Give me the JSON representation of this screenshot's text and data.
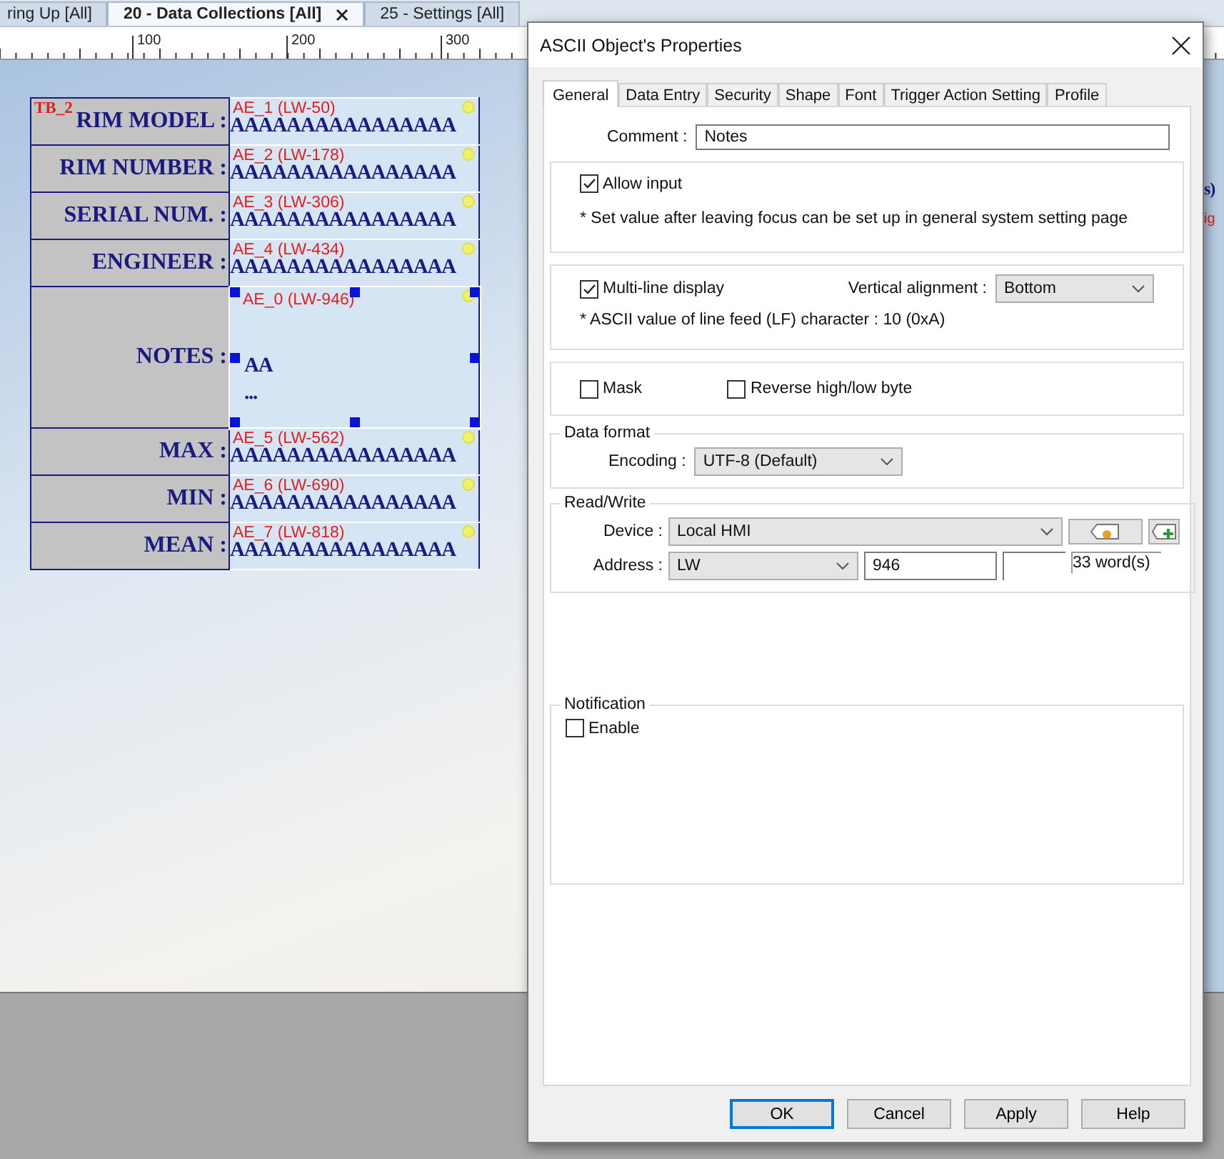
{
  "editor_tabs": [
    {
      "label": "ring Up [All]",
      "selected": false,
      "closable": false
    },
    {
      "label": "20 - Data Collections [All]",
      "selected": true,
      "closable": true
    },
    {
      "label": "25 - Settings [All]",
      "selected": false,
      "closable": false
    }
  ],
  "ruler": {
    "labels": [
      "100",
      "200",
      "300"
    ]
  },
  "canvas": {
    "table_tag": "TB_2",
    "rows": [
      {
        "label": "RIM MODEL :",
        "tag": "AE_1 (LW-50)",
        "kind": "single",
        "lines": [
          "AAAAAAAAAAAAAAAA"
        ],
        "selected": false
      },
      {
        "label": "RIM NUMBER :",
        "tag": "AE_2 (LW-178)",
        "kind": "single",
        "lines": [
          "AAAAAAAAAAAAAAAA"
        ],
        "selected": false
      },
      {
        "label": "SERIAL NUM. :",
        "tag": "AE_3 (LW-306)",
        "kind": "single",
        "lines": [
          "AAAAAAAAAAAAAAAA"
        ],
        "selected": false
      },
      {
        "label": "ENGINEER :",
        "tag": "AE_4 (LW-434)",
        "kind": "single",
        "lines": [
          "AAAAAAAAAAAAAAAA"
        ],
        "selected": false
      },
      {
        "label": "NOTES :",
        "tag": "AE_0 (LW-946)",
        "kind": "multi",
        "lines": [
          "AA",
          "..."
        ],
        "selected": true
      },
      {
        "label": "MAX :",
        "tag": "AE_5 (LW-562)",
        "kind": "single",
        "lines": [
          "AAAAAAAAAAAAAAAA"
        ],
        "selected": false
      },
      {
        "label": "MIN :",
        "tag": "AE_6 (LW-690)",
        "kind": "single",
        "lines": [
          "AAAAAAAAAAAAAAAA"
        ],
        "selected": false
      },
      {
        "label": "MEAN :",
        "tag": "AE_7 (LW-818)",
        "kind": "single",
        "lines": [
          "AAAAAAAAAAAAAAAA"
        ],
        "selected": false
      }
    ],
    "edge_texts": [
      {
        "text": "s)",
        "kind": "value"
      },
      {
        "text": "ig",
        "kind": "tag"
      }
    ]
  },
  "dialog": {
    "title": "ASCII Object's Properties",
    "tabs": [
      {
        "label": "General",
        "selected": true
      },
      {
        "label": "Data Entry",
        "selected": false
      },
      {
        "label": "Security",
        "selected": false
      },
      {
        "label": "Shape",
        "selected": false
      },
      {
        "label": "Font",
        "selected": false
      },
      {
        "label": "Trigger Action Setting",
        "selected": false
      },
      {
        "label": "Profile",
        "selected": false
      }
    ],
    "comment": {
      "label": "Comment :",
      "value": "Notes"
    },
    "allow_input": {
      "label": "Allow input",
      "checked": true,
      "note": "* Set value after leaving focus can be set up in general system setting page"
    },
    "multi_line": {
      "label": "Multi-line display",
      "checked": true,
      "valign_label": "Vertical alignment :",
      "valign": "Bottom",
      "note": "* ASCII value of line feed (LF) character : 10 (0xA)"
    },
    "mask": {
      "label": "Mask",
      "checked": false
    },
    "reverse_byte": {
      "label": "Reverse high/low byte",
      "checked": false
    },
    "data_format": {
      "title": "Data format",
      "encoding_label": "Encoding :",
      "encoding": "UTF-8 (Default)"
    },
    "read_write": {
      "title": "Read/Write",
      "device_label": "Device :",
      "device": "Local HMI",
      "address_label": "Address :",
      "address_type": "LW",
      "address": "946",
      "size": "33 word(s)"
    },
    "notification": {
      "title": "Notification",
      "enable": {
        "label": "Enable",
        "checked": false
      }
    },
    "buttons": [
      {
        "label": "OK",
        "default": true
      },
      {
        "label": "Cancel",
        "default": false
      },
      {
        "label": "Apply",
        "default": false
      },
      {
        "label": "Help",
        "default": false
      }
    ]
  }
}
